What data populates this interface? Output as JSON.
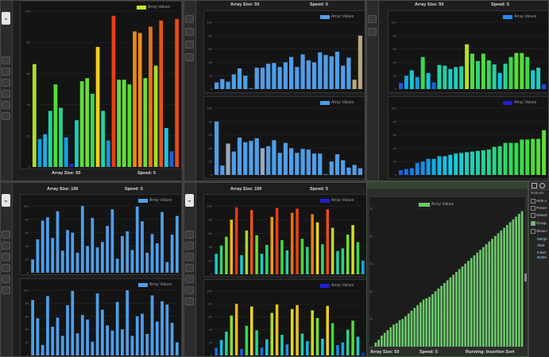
{
  "windows": [
    {
      "id": "w1",
      "array_size": "Array Size: 50",
      "speed": "Speed: 5",
      "legend": "Array Values",
      "legend_color": "#b9f020"
    },
    {
      "id": "w2",
      "array_size": "Array Size: 50",
      "speed": "Speed: 5",
      "legend": "Array Values",
      "legend_color": "#4f9ee8",
      "legend2": "Array Values",
      "legend2_color": "#4f9ee8"
    },
    {
      "id": "w3",
      "array_size": "Array Size: 50",
      "speed": "Speed: 5",
      "legend": "Array Values",
      "legend_color": "#1e90ff",
      "legend2": "Array Values",
      "legend2_color": "#2020d0"
    },
    {
      "id": "w4",
      "array_size": "Array Size: 100",
      "speed": "Speed: 5",
      "legend": "Array Values",
      "legend_color": "#4f9ee8",
      "legend2": "Array Values",
      "legend2_color": "#4f9ee8"
    },
    {
      "id": "w5",
      "array_size": "Array Size: 100",
      "speed": "Speed: 5",
      "legend": "Array Values",
      "legend_color": "#2020d0",
      "legend2": "Array Values",
      "legend2_color": "#2020d0"
    },
    {
      "id": "w6",
      "array_size": "Array Size: 50",
      "speed": "Speed: 5",
      "running": "Running: Insertion Sort",
      "legend": "Array Values",
      "legend_color": "#6cc86c"
    }
  ],
  "select_value": "⌄",
  "right_pane": {
    "header": "Notexes",
    "items": [
      "Hide n",
      "Preser",
      "Selecti",
      "Group",
      "Show t"
    ],
    "code": [
      "Merge",
      "Start",
      "Insert",
      "Buttor"
    ]
  },
  "chart_data": [
    {
      "type": "bar",
      "series": [
        {
          "values": [
            66,
            18,
            21,
            36,
            53,
            38,
            19,
            2,
            30,
            55,
            57,
            47,
            77,
            36,
            17,
            97,
            56,
            56,
            53,
            87,
            86,
            57,
            90,
            65,
            94,
            25,
            10,
            95
          ]
        }
      ],
      "ylim": [
        0,
        100
      ]
    },
    {
      "type": "bar",
      "series": [
        {
          "values": [
            10,
            15,
            11,
            22,
            31,
            20,
            1,
            32,
            32,
            38,
            39,
            33,
            40,
            48,
            33,
            52,
            43,
            40,
            55,
            51,
            49,
            56,
            35,
            47,
            14,
            80
          ]
        }
      ],
      "ylim": [
        0,
        100
      ]
    },
    {
      "type": "bar",
      "series": [
        {
          "values": [
            9,
            20,
            28,
            18,
            48,
            24,
            10,
            36,
            35,
            30,
            33,
            34,
            67,
            53,
            42,
            53,
            43,
            37,
            24,
            38,
            48,
            54,
            54,
            48,
            28,
            32,
            7
          ]
        }
      ],
      "ylim": [
        0,
        100
      ]
    },
    {
      "type": "bar",
      "series": [
        {
          "values": [
            20,
            50,
            78,
            83,
            52,
            92,
            33,
            64,
            60,
            30,
            100,
            40,
            82,
            38,
            46,
            70,
            95,
            21,
            55,
            62,
            34,
            99,
            77,
            30,
            58,
            44,
            91,
            16,
            57,
            85
          ]
        }
      ],
      "ylim": [
        0,
        100
      ]
    },
    {
      "type": "bar",
      "series": [
        {
          "values": [
            30,
            42,
            55,
            80,
            98,
            28,
            64,
            94,
            57,
            30,
            43,
            84,
            97,
            50,
            35,
            90,
            96,
            52,
            40,
            88,
            76,
            44,
            95,
            68,
            34,
            38,
            58,
            72,
            47,
            20
          ]
        }
      ],
      "ylim": [
        0,
        100
      ]
    },
    {
      "type": "bar",
      "series": [
        {
          "values": [
            3,
            5,
            8,
            10,
            12,
            14,
            16,
            17,
            19,
            20,
            22,
            24,
            26,
            28,
            30,
            32,
            34,
            35,
            36,
            38,
            40,
            42,
            44,
            46,
            48,
            50,
            52,
            54,
            56,
            58,
            60,
            62,
            64,
            66,
            68,
            70,
            72,
            74,
            76,
            78,
            80,
            82,
            84,
            86,
            88,
            90,
            92,
            94,
            96,
            98
          ]
        }
      ],
      "ylim": [
        0,
        100
      ]
    }
  ]
}
